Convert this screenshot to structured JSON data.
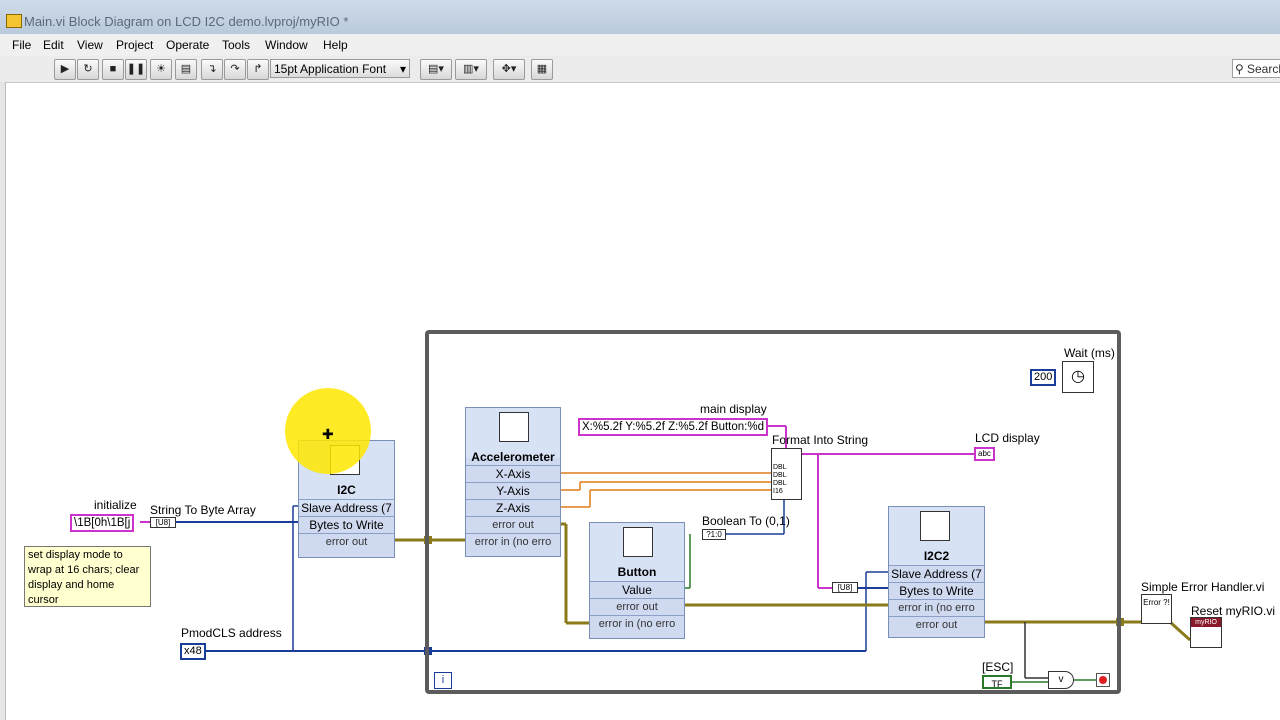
{
  "window": {
    "title": "Main.vi Block Diagram on LCD I2C demo.lvproj/myRIO *"
  },
  "menu": [
    "File",
    "Edit",
    "View",
    "Project",
    "Operate",
    "Tools",
    "Window",
    "Help"
  ],
  "toolbar": {
    "font_label": "15pt Application Font",
    "search_label": "Search"
  },
  "diagram": {
    "initialize_label": "initialize",
    "initialize_value": "\\1B[0h\\1B[j",
    "string_to_byte_label": "String To Byte Array",
    "string_to_byte_glyph": "[U8]",
    "comment": "set display mode to wrap at 16 chars; clear display and home cursor",
    "pmod_label": "PmodCLS address",
    "pmod_value": "x48",
    "i2c_vi": {
      "name": "I2C",
      "rows": [
        "Slave Address (7",
        "Bytes to Write",
        "error out"
      ]
    },
    "accel_vi": {
      "name": "Accelerometer",
      "rows": [
        "X-Axis",
        "Y-Axis",
        "Z-Axis",
        "error out",
        "error in (no erro"
      ]
    },
    "button_vi": {
      "name": "Button",
      "rows": [
        "Value",
        "error out",
        "error in (no erro"
      ]
    },
    "i2c2_vi": {
      "name": "I2C2",
      "rows": [
        "Slave Address (7",
        "Bytes to Write",
        "error in (no erro",
        "error out"
      ]
    },
    "main_display_label": "main display",
    "main_display_value": "X:%5.2f Y:%5.2f Z:%5.2f Button:%d",
    "format_into_string_label": "Format Into String",
    "lcd_display_label": "LCD display",
    "lcd_display_glyph": "abc",
    "boolean_to_label": "Boolean To (0,1)",
    "boolean_glyph": "?1:0",
    "wait_label": "Wait (ms)",
    "wait_value": "200",
    "esc_label": "[ESC]",
    "esc_value": "TF",
    "loop_iteration": "i",
    "simple_error_label": "Simple Error Handler.vi",
    "simple_error_glyph": "Error ?!",
    "reset_label": "Reset myRIO.vi",
    "reset_glyph": "myRIO",
    "u8_glyph": "[U8]",
    "dbl": "DBL",
    "i16": "I16"
  },
  "colors": {
    "string_wire": "#cc33cc",
    "numeric_wire": "#1a3d99",
    "error_wire": "#8a7a1a",
    "cursor_highlight": "#ffe600"
  }
}
